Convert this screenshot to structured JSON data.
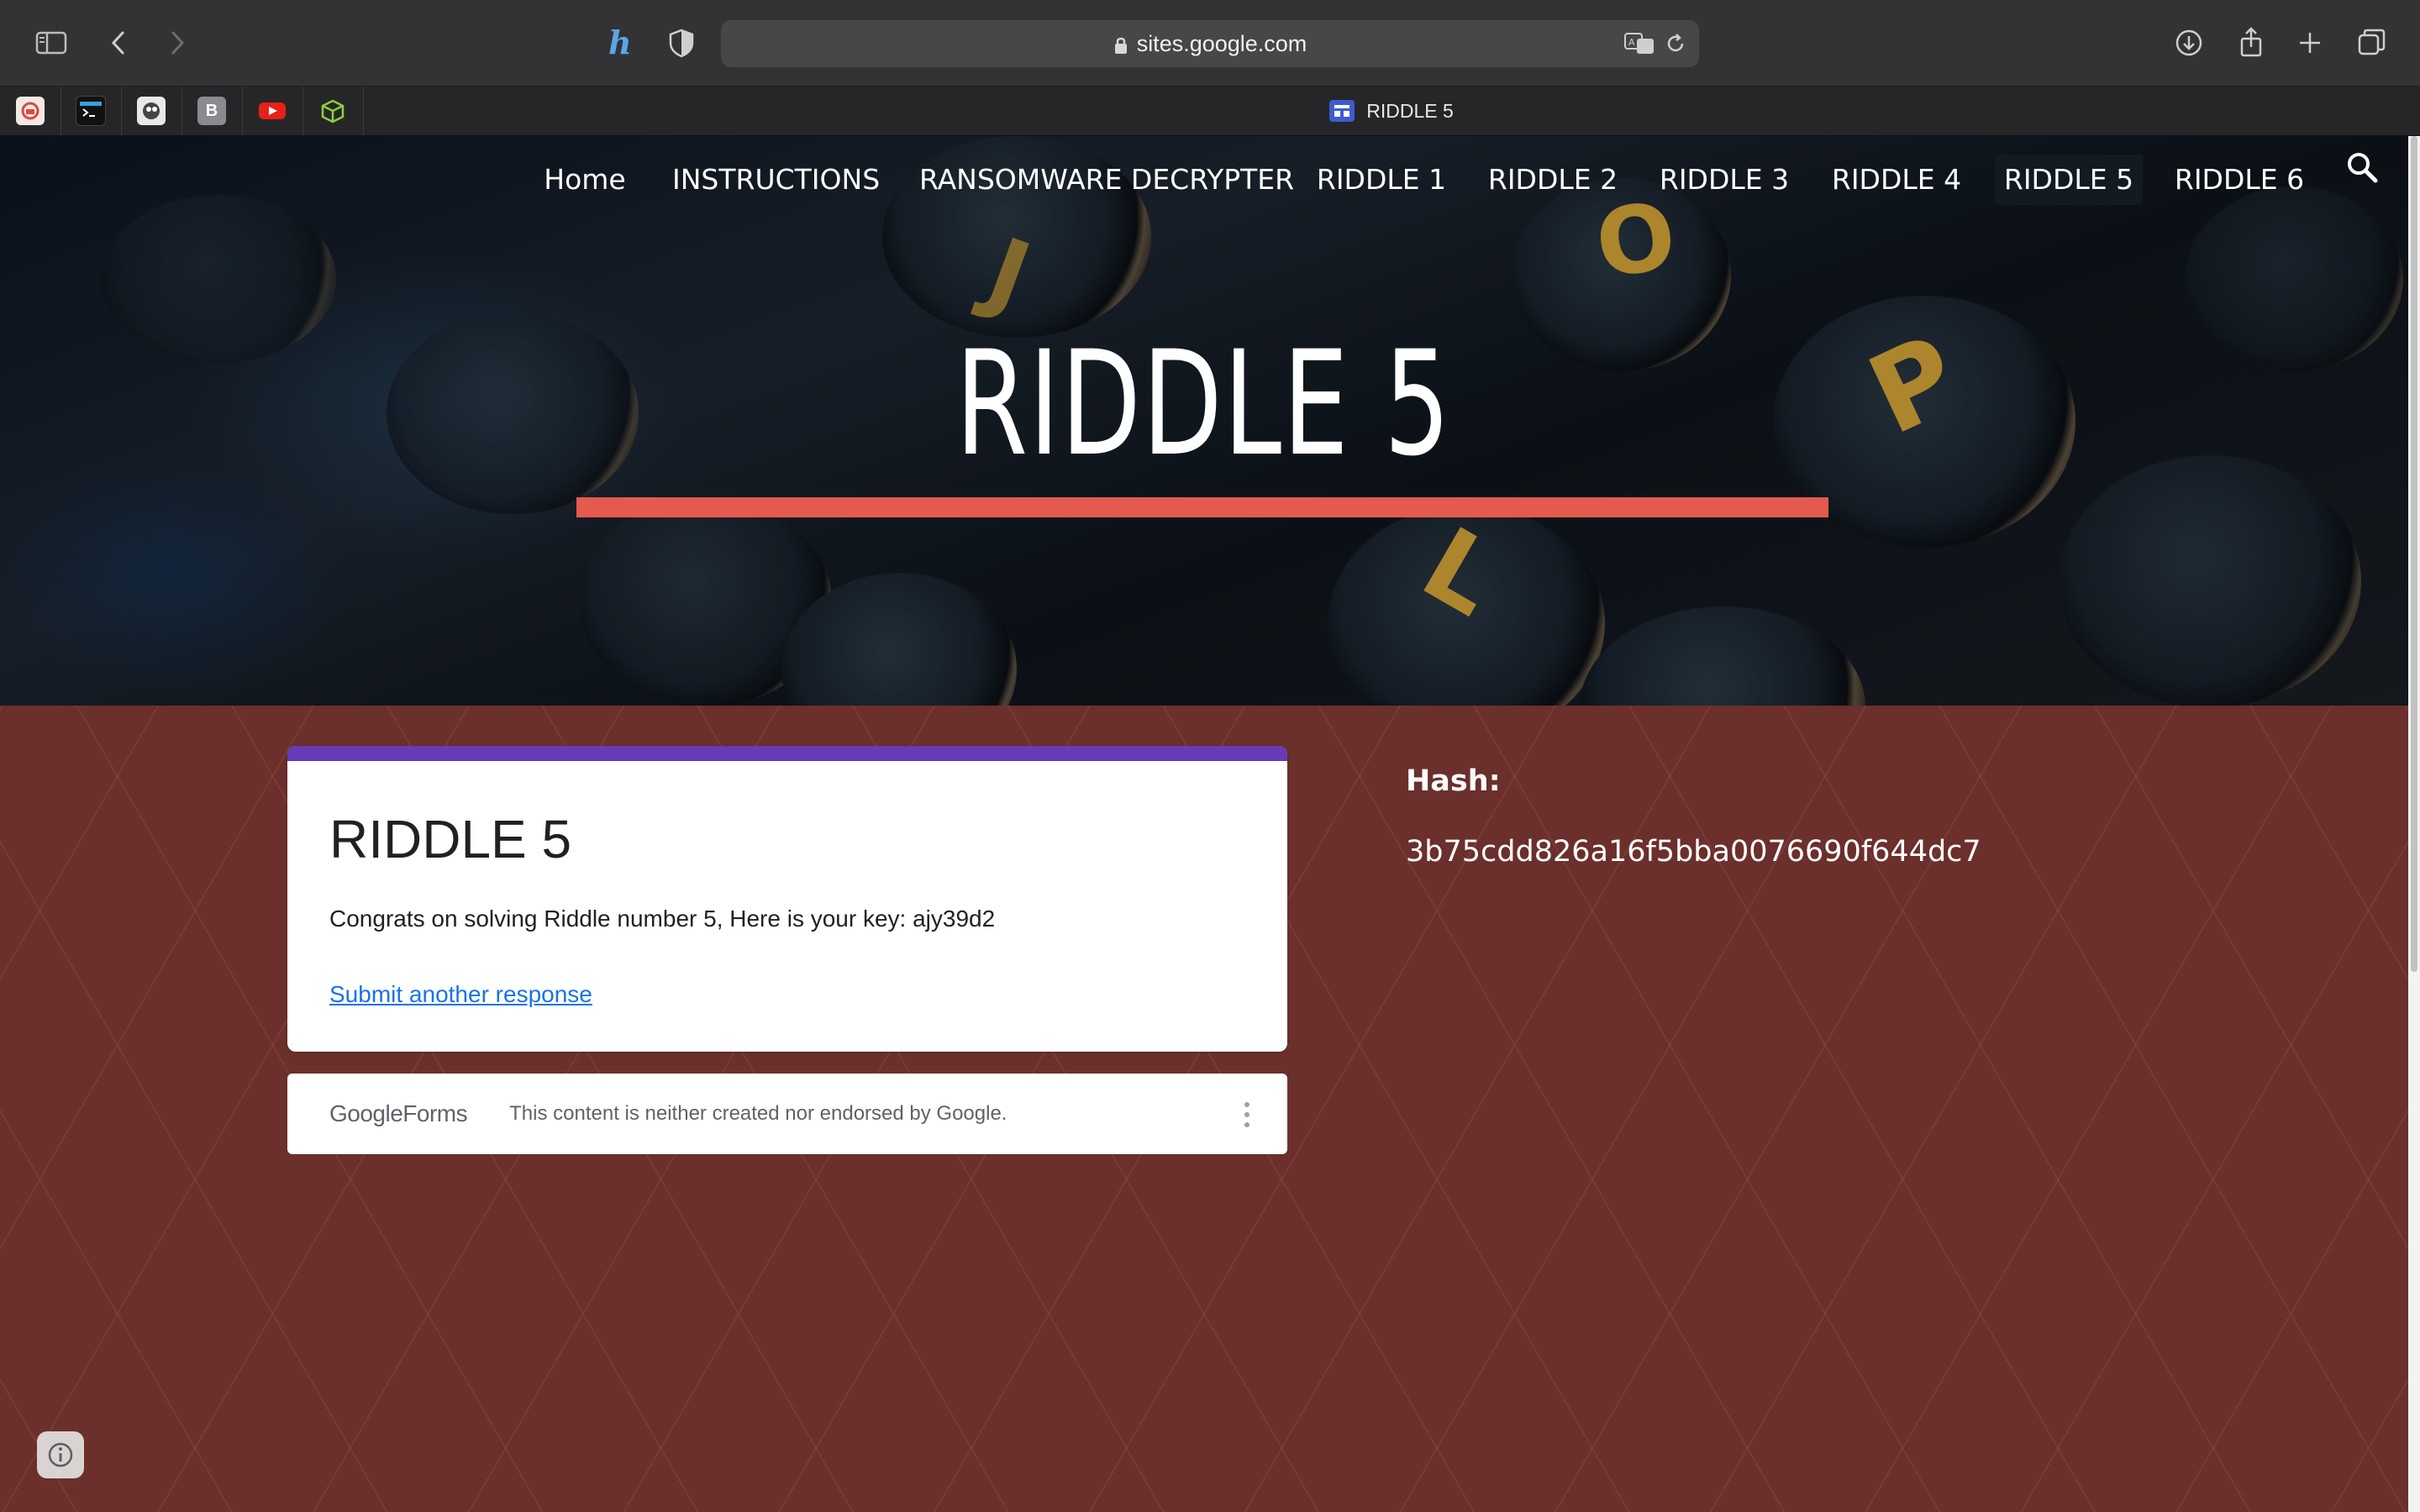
{
  "browser": {
    "url": "sites.google.com",
    "active_tab_title": "RIDDLE 5",
    "pinned_tabs": [
      {
        "icon": "cloud-app-icon",
        "color": "#d94b3f"
      },
      {
        "icon": "terminal-icon",
        "color": "#1b1b1b"
      },
      {
        "icon": "mascot-app-icon",
        "color": "#e8e8e8"
      },
      {
        "icon": "b-letter-icon",
        "label": "B",
        "color": "#8a8a90"
      },
      {
        "icon": "youtube-icon",
        "color": "#e62117"
      },
      {
        "icon": "cube-icon",
        "color": "#8bd13a"
      }
    ]
  },
  "site": {
    "nav": [
      {
        "label": "Home"
      },
      {
        "label": "INSTRUCTIONS"
      },
      {
        "label": "RANSOMWARE DECRYPTER"
      },
      {
        "label": "RIDDLE 1"
      },
      {
        "label": "RIDDLE 2"
      },
      {
        "label": "RIDDLE 3"
      },
      {
        "label": "RIDDLE 4"
      },
      {
        "label": "RIDDLE 5",
        "active": true
      },
      {
        "label": "RIDDLE 6"
      }
    ],
    "hero_title": "RIDDLE 5",
    "accent_color": "#e35a4f",
    "form": {
      "title": "RIDDLE 5",
      "message": "Congrats on solving Riddle number 5, Here is your key: ajy39d2",
      "link": "Submit another response",
      "brand_google": "Google",
      "brand_forms": "Forms",
      "disclaimer": "This content is neither created nor endorsed by Google.",
      "header_color": "#673ab7"
    },
    "hash": {
      "label": "Hash:",
      "value": "3b75cdd826a16f5bba0076690f644dc7"
    }
  }
}
